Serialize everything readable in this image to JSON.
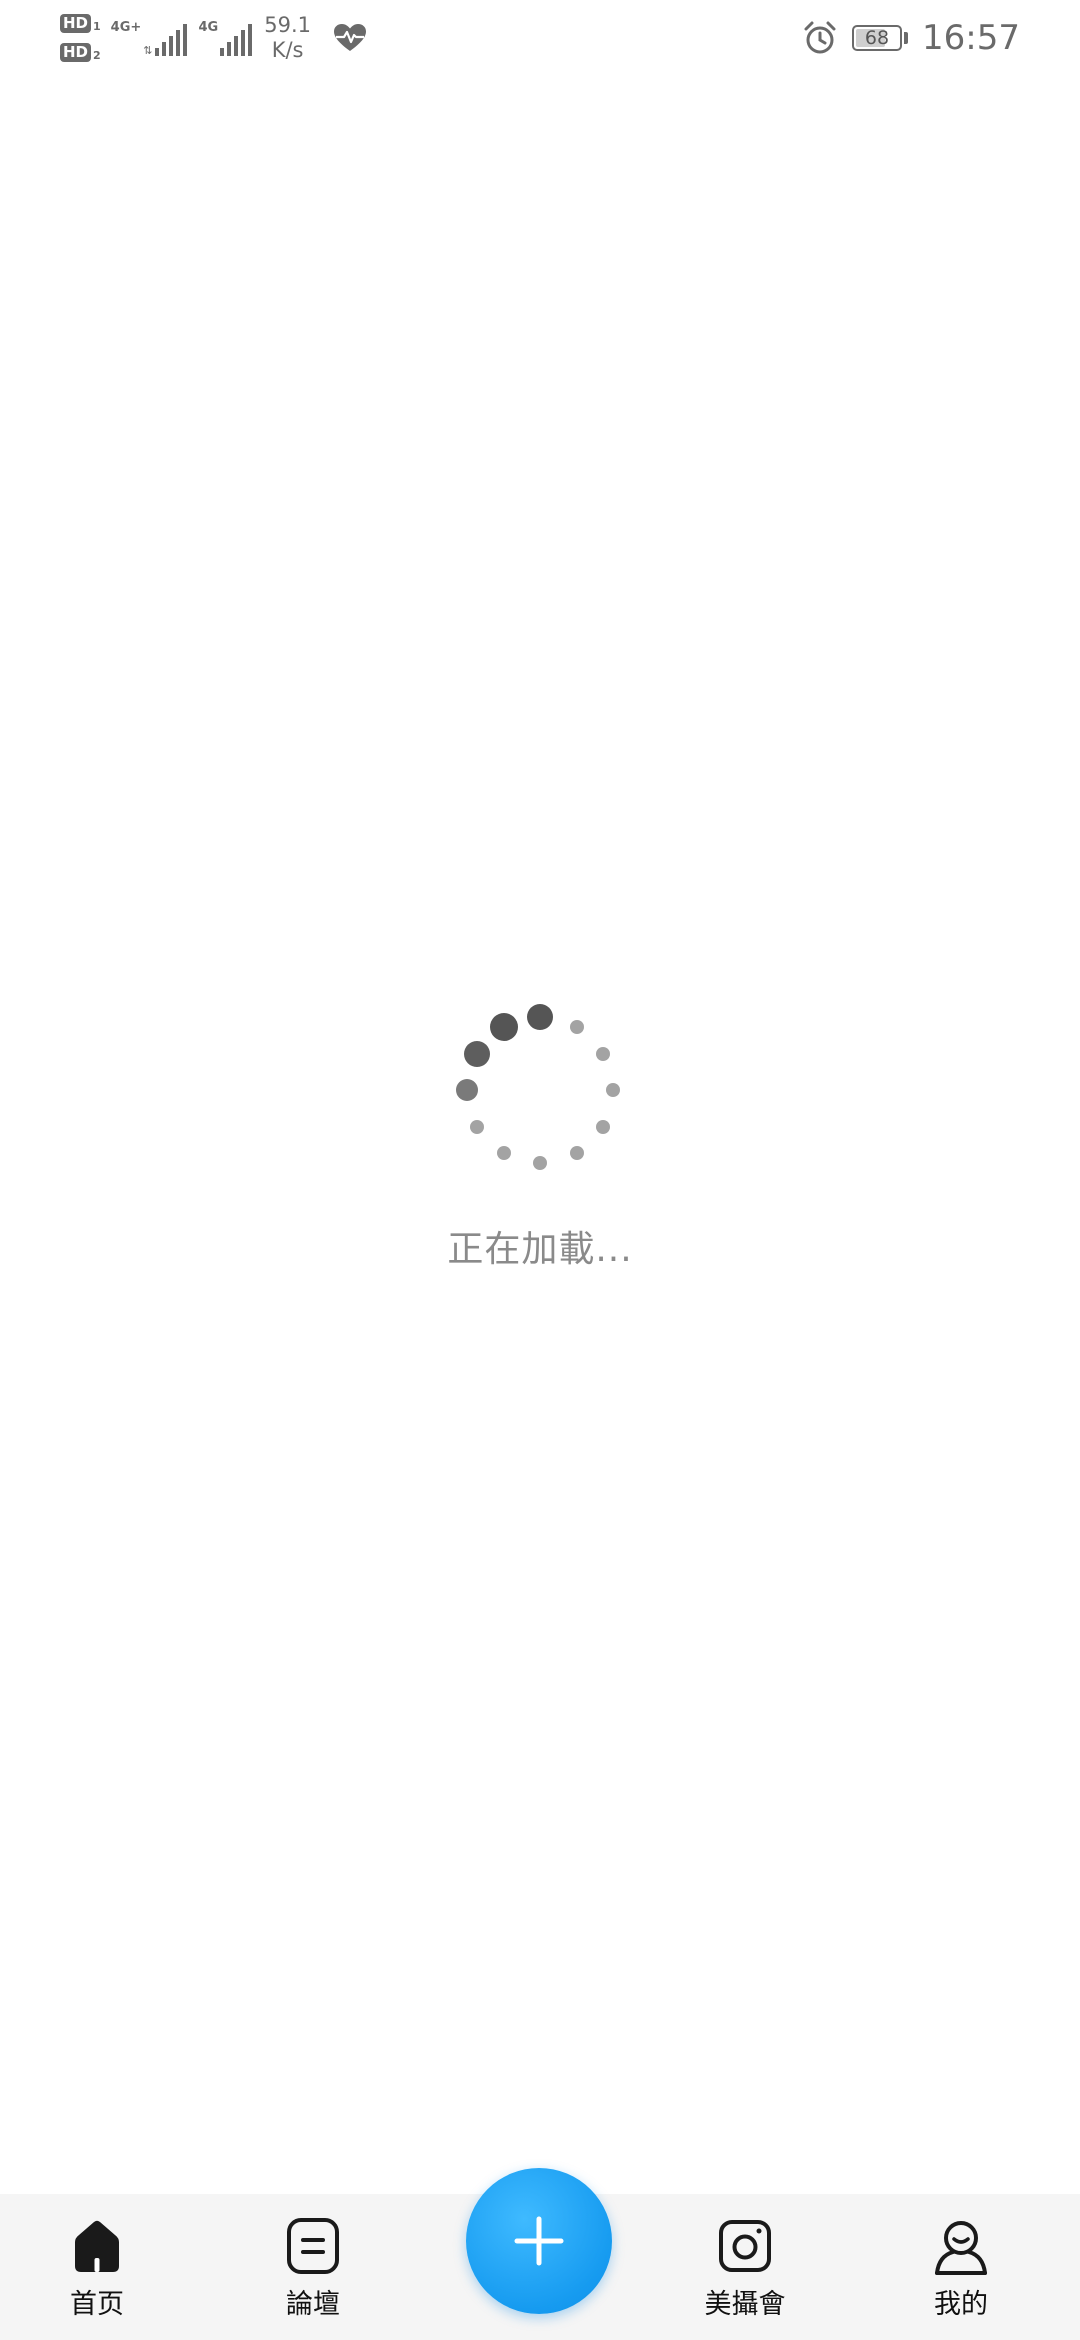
{
  "status_bar": {
    "sim1_badge": "HD",
    "sim1_index": "1",
    "sim2_badge": "HD",
    "sim2_index": "2",
    "network1_type": "4G+",
    "network2_type": "4G",
    "speed_value": "59.1",
    "speed_unit": "K/s",
    "battery_level": "68",
    "time": "16:57"
  },
  "loader": {
    "text": "正在加載..."
  },
  "tab_bar": {
    "tabs": [
      {
        "label": "首页",
        "icon": "home-icon"
      },
      {
        "label": "論壇",
        "icon": "forum-icon"
      },
      {
        "label": "美攝會",
        "icon": "camera-icon"
      },
      {
        "label": "我的",
        "icon": "profile-icon"
      }
    ],
    "fab_icon": "plus-icon"
  },
  "colors": {
    "fab": "#169bf0",
    "tab_bar_bg": "#f5f5f5",
    "loading_text": "#8a8a8a"
  }
}
